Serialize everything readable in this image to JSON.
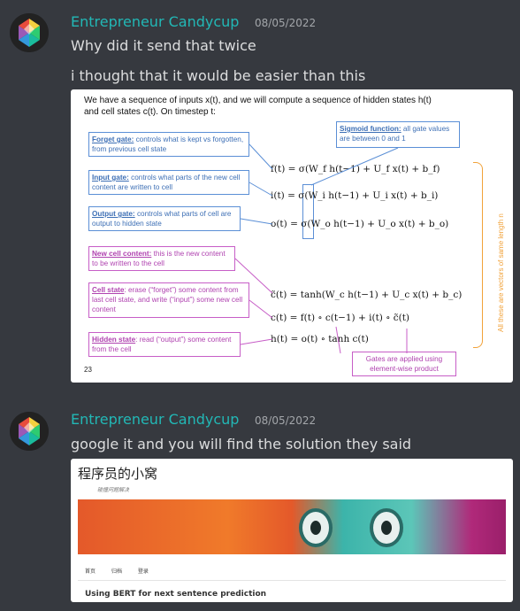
{
  "messages": [
    {
      "username": "Entrepreneur Candycup",
      "timestamp": "08/05/2022",
      "lines": [
        "Why did it send that twice",
        "i thought that it would be easier than this"
      ],
      "attachment": {
        "intro_line1": "We have a sequence of inputs x(t), and we will compute a sequence of hidden states h(t)",
        "intro_line2": "and cell states c(t).  On timestep t:",
        "sigmoid_label": "Sigmoid function:",
        "sigmoid_text": " all gate values are between 0 and 1",
        "forget_label": "Forget gate:",
        "forget_text": " controls what is kept vs forgotten, from previous cell state",
        "input_label": "Input gate:",
        "input_text": " controls what parts of the new cell content are written to cell",
        "output_label": "Output gate:",
        "output_text": " controls what parts of cell are output to hidden state",
        "newcell_label": "New cell content:",
        "newcell_text": " this is the new content to be written to the cell",
        "cellstate_label": "Cell state",
        "cellstate_text": ": erase (“forget”) some content from last cell state, and write (“input”) some new cell content",
        "hidden_label": "Hidden state",
        "hidden_text": ": read (“output”) some content from the cell",
        "gates_applied": "Gates are applied using element-wise product",
        "vertical_note": "All these are vectors of same length n",
        "eq_f": "f(t) = σ(W_f h(t−1) + U_f x(t) + b_f)",
        "eq_i": "i(t) = σ(W_i h(t−1) + U_i x(t) + b_i)",
        "eq_o": "o(t) = σ(W_o h(t−1) + U_o x(t) + b_o)",
        "eq_c_tilde": "c̃(t) = tanh(W_c h(t−1) + U_c x(t) + b_c)",
        "eq_c": "c(t) = f(t) ∘ c(t−1) + i(t) ∘ c̃(t)",
        "eq_h": "h(t) = o(t) ∘ tanh c(t)",
        "page_number": "23"
      }
    },
    {
      "username": "Entrepreneur Candycup",
      "timestamp": "08/05/2022",
      "lines": [
        "google it and you will find the solution they said"
      ],
      "attachment": {
        "site_title": "程序员的小窝",
        "site_subtitle": "碰撞问题解决",
        "nav": [
          "首页",
          "归档",
          "登录"
        ],
        "post_title": "Using BERT for next sentence prediction"
      }
    }
  ],
  "colors": {
    "username": "#22b8b6",
    "background": "#36393f",
    "text": "#dcddde",
    "timestamp": "#a3a6aa"
  },
  "icons": {
    "avatar": "faceted-gem-icon"
  }
}
